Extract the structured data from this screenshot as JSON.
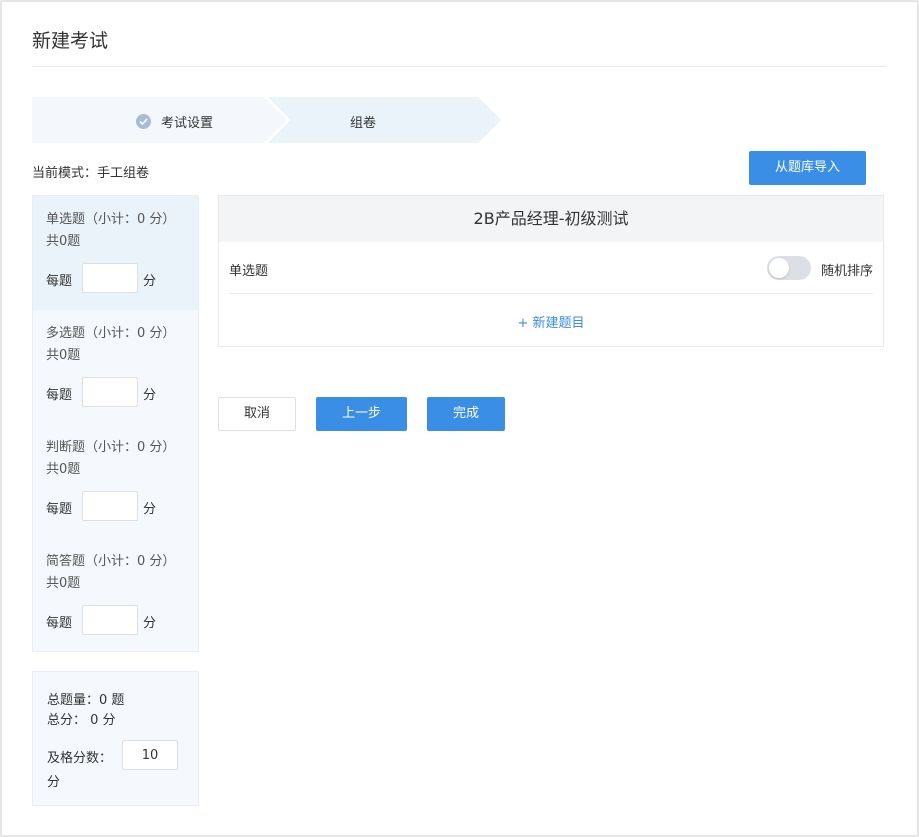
{
  "page": {
    "title": "新建考试"
  },
  "steps": [
    {
      "label": "考试设置",
      "status": "done"
    },
    {
      "label": "组卷",
      "status": "current"
    }
  ],
  "mode": {
    "text": "当前模式：手工组卷"
  },
  "import_button": {
    "label": "从题库导入"
  },
  "question_types": [
    {
      "head": "单选题（小计：0 分）",
      "count": "共0题",
      "per_label": "每题",
      "score_value": "",
      "unit": "分",
      "active": true
    },
    {
      "head": "多选题（小计：0 分）",
      "count": "共0题",
      "per_label": "每题",
      "score_value": "",
      "unit": "分",
      "active": false
    },
    {
      "head": "判断题（小计：0 分）",
      "count": "共0题",
      "per_label": "每题",
      "score_value": "",
      "unit": "分",
      "active": false
    },
    {
      "head": "简答题（小计：0 分）",
      "count": "共0题",
      "per_label": "每题",
      "score_value": "",
      "unit": "分",
      "active": false
    }
  ],
  "summary": {
    "total_questions": "总题量：0 题",
    "total_score": "总分： 0 分",
    "pass_label": "及格分数：",
    "pass_value": "10",
    "pass_unit": "分"
  },
  "exam_card": {
    "title": "2B产品经理-初级测试",
    "section_label": "单选题",
    "random_label": "随机排序",
    "random_on": false,
    "add_label": "+ 新建题目"
  },
  "actions": {
    "cancel": "取消",
    "prev": "上一步",
    "done": "完成"
  },
  "colors": {
    "primary": "#3a8ee6",
    "panel_bg": "#f5f9fd",
    "step_done_bg": "#f4f8fc",
    "step_current_bg": "#eaf2fa"
  }
}
